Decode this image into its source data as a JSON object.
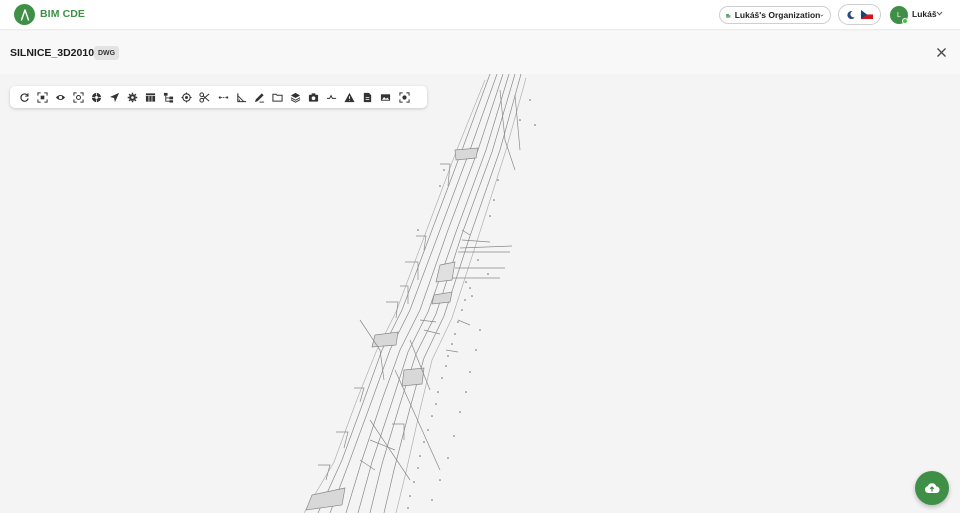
{
  "app": {
    "name": "BIM CDE"
  },
  "header": {
    "organization": "Lukáš's Organization",
    "user_initial": "L",
    "user_name": "Lukáš"
  },
  "document": {
    "title": "SILNICE_3D2010",
    "format": "DWG"
  },
  "toolbar": {
    "tools": [
      "reset-view-icon",
      "fit-selection-icon",
      "visibility-icon",
      "focus-icon",
      "explode-icon",
      "navigate-icon",
      "settings-icon",
      "table-icon",
      "hierarchy-icon",
      "target-icon",
      "section-cut-icon",
      "measure-distance-icon",
      "measure-angle-icon",
      "markup-icon",
      "folder-icon",
      "layers-icon",
      "screenshot-icon",
      "compare-icon",
      "warning-icon",
      "document-icon",
      "viewpoint-icon",
      "scan-icon"
    ]
  },
  "colors": {
    "brand_green": "#3f8f47",
    "online_green": "#43c34a"
  }
}
